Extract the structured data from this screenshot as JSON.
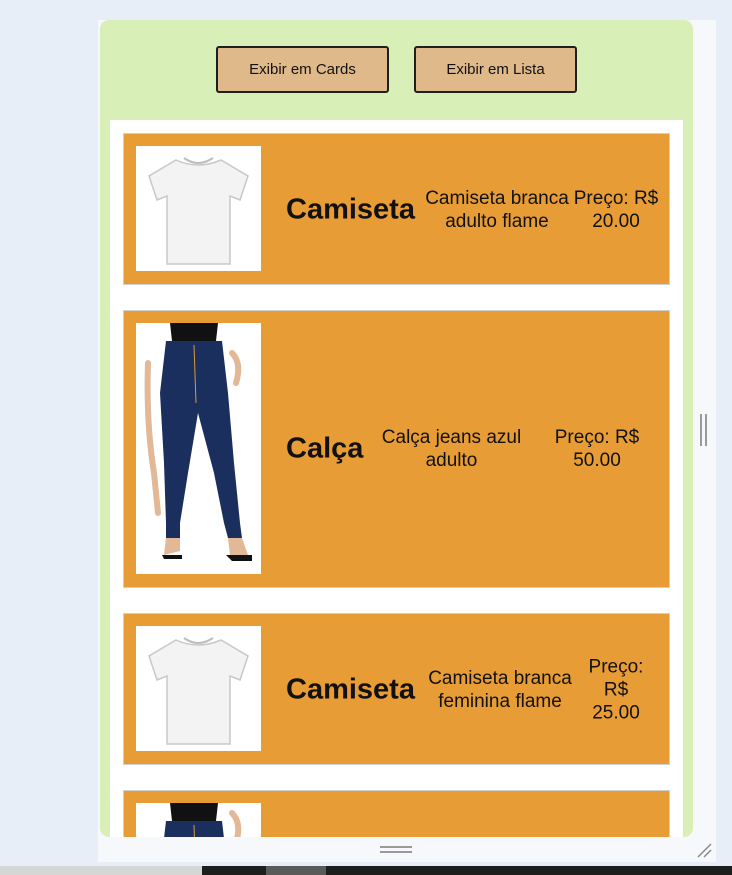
{
  "toolbar": {
    "cards_label": "Exibir em Cards",
    "list_label": "Exibir em Lista"
  },
  "products": [
    {
      "name": "Camiseta",
      "description": "Camiseta branca adulto flame",
      "price_text": "Preço: R$ 20.00",
      "image_icon": "white-tshirt-icon"
    },
    {
      "name": "Calça",
      "description": "Calça jeans azul adulto",
      "price_text": "Preço: R$ 50.00",
      "image_icon": "blue-jeans-icon"
    },
    {
      "name": "Camiseta",
      "description": "Camiseta branca feminina flame",
      "price_text": "Preço: R$ 25.00",
      "image_icon": "white-tshirt-icon"
    },
    {
      "name": "",
      "description": "",
      "price_text": "",
      "image_icon": "blue-jeans-icon"
    }
  ],
  "colors": {
    "panel_bg": "#d9efb8",
    "button_bg": "#e0b98a",
    "item_bg": "#e89c36",
    "list_bg": "#ffffff",
    "jeans": "#1b2f5e"
  }
}
